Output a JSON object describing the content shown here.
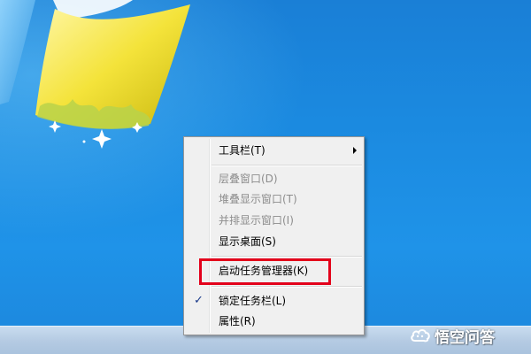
{
  "desktop": {
    "background_color": "#1b8ae0",
    "logo_icon": "windows-7-flag-logo"
  },
  "context_menu": {
    "items": [
      {
        "label": "工具栏(T)",
        "enabled": true,
        "submenu": true
      },
      {
        "label": "层叠窗口(D)",
        "enabled": false
      },
      {
        "label": "堆叠显示窗口(T)",
        "enabled": false
      },
      {
        "label": "并排显示窗口(I)",
        "enabled": false
      },
      {
        "label": "显示桌面(S)",
        "enabled": true
      },
      {
        "label": "启动任务管理器(K)",
        "enabled": true,
        "highlighted": true
      },
      {
        "label": "锁定任务栏(L)",
        "enabled": true,
        "checked": true
      },
      {
        "label": "属性(R)",
        "enabled": true
      }
    ],
    "check_mark": "✓",
    "highlight_color": "#e3001b"
  },
  "watermark": {
    "text": "悟空问答",
    "icon": "wukong-cloud-icon"
  }
}
